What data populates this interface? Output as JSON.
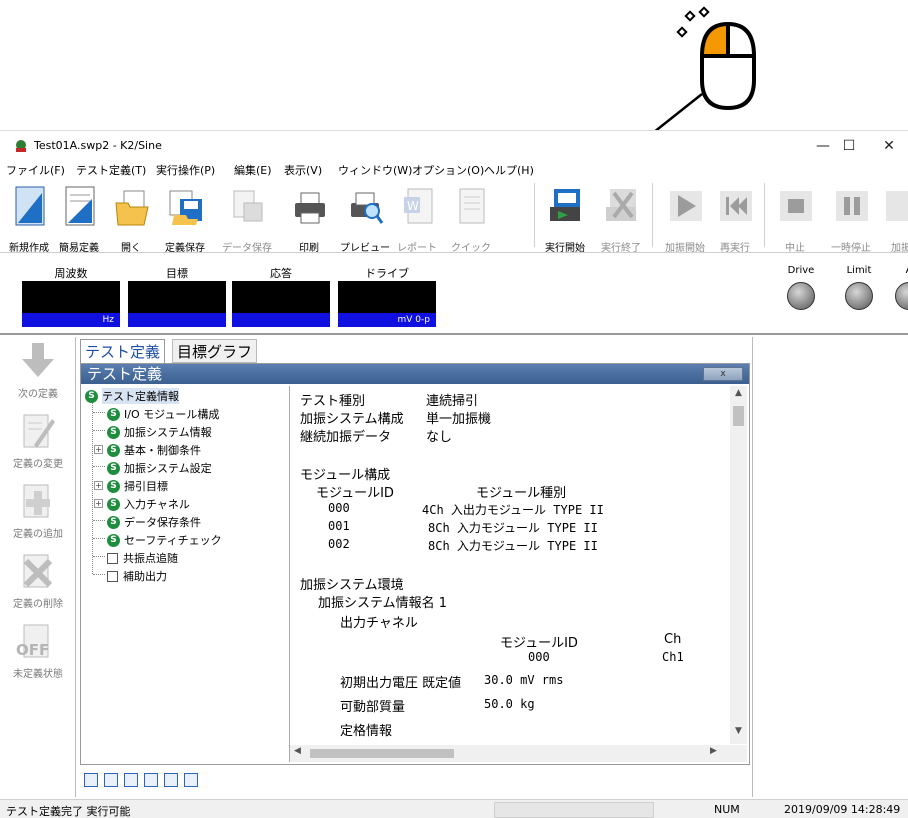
{
  "window": {
    "title": "Test01A.swp2 - K2/Sine",
    "minimize": "—",
    "maximize": "☐",
    "close": "✕"
  },
  "menu": [
    "ファイル(F)",
    "テスト定義(T)",
    "実行操作(P)",
    "編集(E)",
    "表示(V)",
    "ウィンドウ(W)",
    "オプション(O)",
    "ヘルプ(H)"
  ],
  "toolbar": {
    "new": "新規作成",
    "simple": "簡易定義",
    "open": "開く",
    "save_def": "定義保存",
    "save_data": "データ保存",
    "print": "印刷",
    "preview": "プレビュー",
    "report": "レポート",
    "quick": "クイック",
    "run_start": "実行開始",
    "run_end": "実行終了",
    "excite_start": "加振開始",
    "rerun": "再実行",
    "stop": "中止",
    "pause": "一時停止",
    "excite_end": "加振"
  },
  "monitor": {
    "frequency": {
      "label": "周波数",
      "unit": "Hz"
    },
    "target": {
      "label": "目標",
      "unit": ""
    },
    "response": {
      "label": "応答",
      "unit": ""
    },
    "drive": {
      "label": "ドライブ",
      "unit": "mV 0-p"
    },
    "leds": [
      "Drive",
      "Limit",
      "A"
    ]
  },
  "leftbar": {
    "next": "次の定義",
    "change": "定義の変更",
    "add": "定義の追加",
    "delete": "定義の削除",
    "undefined": "未定義状態",
    "off_text": "OFF"
  },
  "tabs": {
    "definition": "テスト定義",
    "target_graph": "目標グラフ"
  },
  "panel": {
    "title": "テスト定義",
    "close": "x"
  },
  "tree": [
    {
      "label": "テスト定義情報",
      "icon": "s"
    },
    {
      "label": "I/O モジュール構成",
      "icon": "s"
    },
    {
      "label": "加振システム情報",
      "icon": "s"
    },
    {
      "label": "基本・制御条件",
      "icon": "s"
    },
    {
      "label": "加振システム設定",
      "icon": "s"
    },
    {
      "label": "掃引目標",
      "icon": "s"
    },
    {
      "label": "入力チャネル",
      "icon": "s"
    },
    {
      "label": "データ保存条件",
      "icon": "s"
    },
    {
      "label": "セーフティチェック",
      "icon": "s"
    },
    {
      "label": "共振点追随",
      "icon": "box"
    },
    {
      "label": "補助出力",
      "icon": "box"
    }
  ],
  "detail": {
    "test_type_label": "テスト種別",
    "test_type_value": "連続掃引",
    "system_label": "加振システム構成",
    "system_value": "単一加振機",
    "continue_label": "継続加振データ",
    "continue_value": "なし",
    "module_header": "モジュール構成",
    "col_module_id": "モジュールID",
    "col_module_type": "モジュール種別",
    "modules": [
      {
        "id": "000",
        "type": "4Ch 入出力モジュール TYPE II"
      },
      {
        "id": "001",
        "type": "8Ch 入力モジュール TYPE II"
      },
      {
        "id": "002",
        "type": "8Ch 入力モジュール TYPE II"
      }
    ],
    "env_header": "加振システム環境",
    "env_name": "加振システム情報名 1",
    "output_channel": "出力チャネル",
    "out_col_module": "モジュールID",
    "out_col_ch": "Ch",
    "out_module": "000",
    "out_ch": "Ch1",
    "initial_voltage_label": "初期出力電圧 既定値",
    "initial_voltage_value": "30.0 mV rms",
    "moving_mass_label": "可動部質量",
    "moving_mass_value": "50.0 kg",
    "rating_label": "定格情報"
  },
  "status": {
    "message": "テスト定義完了 実行可能",
    "num": "NUM",
    "datetime": "2019/09/09  14:28:49"
  }
}
